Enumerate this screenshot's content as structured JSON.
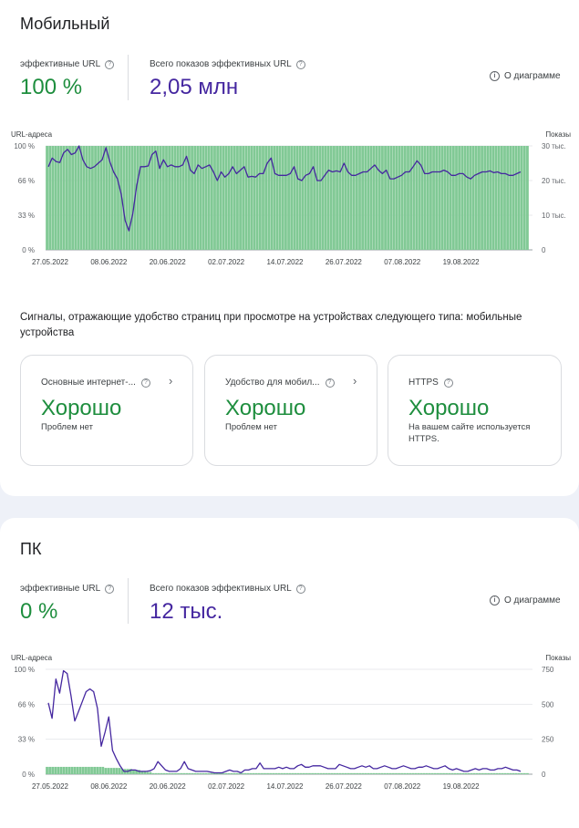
{
  "mobile": {
    "title": "Мобильный",
    "effective_urls_label": "эффективные URL",
    "effective_urls_value": "100 %",
    "impressions_label": "Всего показов эффективных URL",
    "impressions_value": "2,05 млн",
    "about_label": "О диаграмме",
    "signals_text": "Сигналы, отражающие удобство страниц при просмотре на устройствах следующего типа: мобильные устройства",
    "signal_cards": [
      {
        "title": "Основные интернет-...",
        "status": "Хорошо",
        "desc": "Проблем нет"
      },
      {
        "title": "Удобство для мобил...",
        "status": "Хорошо",
        "desc": "Проблем нет"
      },
      {
        "title": "HTTPS",
        "status": "Хорошо",
        "desc": "На вашем сайте используется HTTPS."
      }
    ]
  },
  "pc": {
    "title": "ПК",
    "effective_urls_label": "эффективные URL",
    "effective_urls_value": "0 %",
    "impressions_label": "Всего показов эффективных URL",
    "impressions_value": "12 тыс.",
    "about_label": "О диаграмме"
  },
  "colors": {
    "bars": "#81c995",
    "line": "#4527a0",
    "good": "#1e8e3e"
  },
  "chart_data": [
    {
      "type": "bar",
      "x_tick_labels": [
        "27.05.2022",
        "08.06.2022",
        "20.06.2022",
        "02.07.2022",
        "14.07.2022",
        "26.07.2022",
        "07.08.2022",
        "19.08.2022"
      ],
      "left_axis": {
        "label": "URL-адреса",
        "ticks": [
          "0 %",
          "33 %",
          "66 %",
          "100 %"
        ],
        "range": [
          0,
          100
        ]
      },
      "right_axis": {
        "label": "Показы",
        "ticks": [
          "0",
          "10 тыс.",
          "20 тыс.",
          "30 тыс."
        ],
        "range": [
          0,
          30000
        ]
      },
      "series": [
        {
          "axis": "left",
          "type": "bar",
          "values": [
            100,
            100,
            100,
            100,
            100,
            100,
            100,
            100,
            100,
            100,
            100,
            100,
            100,
            100,
            100,
            100,
            100,
            100,
            100,
            100,
            100,
            100,
            100,
            100,
            100,
            100,
            100,
            100,
            100,
            100,
            100,
            100,
            100,
            100,
            100,
            100,
            100,
            100,
            100,
            100,
            100,
            100,
            100,
            100,
            100,
            100,
            100,
            100,
            100,
            100,
            100,
            100,
            100,
            100,
            100,
            100,
            100,
            100,
            100,
            100,
            100,
            100,
            100,
            100,
            100,
            100,
            100,
            100,
            100,
            100,
            100,
            100,
            100,
            100,
            100,
            100,
            100,
            100,
            100,
            100,
            100,
            100,
            100,
            100,
            100,
            100,
            100,
            100,
            100,
            100,
            100,
            100,
            100,
            100,
            100,
            100,
            100,
            100,
            100,
            100,
            100,
            100,
            100,
            100,
            100,
            100,
            100,
            100,
            100,
            100,
            100,
            100,
            100,
            100,
            100,
            100,
            100,
            100,
            100,
            100,
            100,
            100,
            100,
            100,
            100,
            100,
            100,
            100,
            100,
            100,
            100,
            100,
            100,
            100,
            100,
            100,
            100,
            100,
            100,
            100,
            100,
            100,
            100,
            100,
            100,
            100,
            100,
            100,
            100,
            100,
            100,
            100,
            100,
            100,
            100,
            100,
            100,
            100,
            100,
            100,
            100,
            100,
            100,
            100,
            100,
            100,
            100,
            100,
            100,
            100
          ]
        },
        {
          "axis": "right",
          "type": "line",
          "values": [
            24000,
            26500,
            25500,
            25200,
            28000,
            29000,
            27500,
            28000,
            30000,
            26000,
            24000,
            23500,
            24000,
            25000,
            26000,
            29500,
            25500,
            22500,
            20500,
            16000,
            8500,
            5500,
            10500,
            18500,
            24000,
            24000,
            24200,
            27500,
            28500,
            23500,
            26000,
            24000,
            24500,
            24000,
            24000,
            24500,
            27000,
            23000,
            22000,
            24500,
            23500,
            24000,
            24500,
            22500,
            20000,
            22500,
            21000,
            22000,
            24000,
            22000,
            23000,
            24000,
            21000,
            21200,
            21000,
            22000,
            22000,
            25000,
            26500,
            22000,
            21500,
            21500,
            21500,
            22000,
            24000,
            20500,
            20000,
            21500,
            22000,
            24000,
            20000,
            20000,
            21500,
            23000,
            22500,
            22800,
            22500,
            25000,
            22500,
            21500,
            21500,
            22000,
            22500,
            22500,
            23500,
            24500,
            23000,
            22000,
            23000,
            20500,
            20500,
            21000,
            21500,
            22500,
            22500,
            24000,
            25700,
            24500,
            22000,
            22000,
            22500,
            22500,
            22500,
            23000,
            22500,
            21500,
            21500,
            22000,
            22000,
            21000,
            20500,
            21500,
            22000,
            22500,
            22500,
            22800,
            22300,
            22500,
            22000,
            22000,
            21500,
            21500,
            22000,
            22500
          ]
        }
      ]
    },
    {
      "type": "bar",
      "x_tick_labels": [
        "27.05.2022",
        "08.06.2022",
        "20.06.2022",
        "02.07.2022",
        "14.07.2022",
        "26.07.2022",
        "07.08.2022",
        "19.08.2022"
      ],
      "left_axis": {
        "label": "URL-адреса",
        "ticks": [
          "0 %",
          "33 %",
          "66 %",
          "100 %"
        ],
        "range": [
          0,
          100
        ]
      },
      "right_axis": {
        "label": "Показы",
        "ticks": [
          "0",
          "250",
          "500",
          "750"
        ],
        "range": [
          0,
          750
        ]
      },
      "series": [
        {
          "axis": "left",
          "type": "bar",
          "values": [
            7,
            7,
            7,
            7,
            7,
            7,
            7,
            7,
            7,
            7,
            7,
            7,
            7,
            7,
            7,
            7,
            7,
            7,
            7,
            7,
            7,
            6,
            6,
            6,
            6,
            6,
            6,
            5,
            5,
            5,
            5,
            4,
            4,
            4,
            3,
            3,
            2,
            2,
            1,
            1,
            1,
            1,
            1,
            1,
            1,
            1,
            1,
            1,
            1,
            1,
            1,
            1,
            1,
            1,
            1,
            1,
            1,
            1,
            1,
            1,
            1,
            1,
            1,
            1,
            1,
            1,
            1,
            1,
            1,
            1,
            1,
            1,
            1,
            1,
            1,
            1,
            1,
            1,
            1,
            1,
            1,
            1,
            1,
            1,
            1,
            1,
            1,
            1,
            1,
            1,
            1,
            1,
            1,
            1,
            1,
            1,
            1,
            1,
            1,
            1,
            1,
            1,
            1,
            1,
            1,
            1,
            1,
            1,
            1,
            1,
            1,
            1,
            1,
            1,
            1,
            1,
            1,
            1,
            1,
            1,
            1,
            1,
            1,
            1,
            1,
            1,
            1,
            1,
            1,
            1,
            1,
            1,
            1,
            1,
            1,
            1,
            1,
            1,
            1,
            1,
            1,
            1,
            1,
            1,
            1,
            1,
            1,
            1,
            1,
            1,
            1,
            1,
            1,
            1,
            1,
            1,
            1,
            1,
            1,
            1,
            1,
            1,
            1,
            1,
            1,
            1,
            1,
            1,
            1,
            1,
            1,
            1,
            1
          ]
        },
        {
          "axis": "right",
          "type": "line",
          "values": [
            510,
            400,
            680,
            580,
            740,
            720,
            560,
            380,
            450,
            520,
            590,
            610,
            590,
            470,
            200,
            300,
            410,
            170,
            110,
            60,
            20,
            20,
            30,
            30,
            20,
            20,
            20,
            25,
            40,
            90,
            60,
            30,
            20,
            20,
            20,
            40,
            90,
            40,
            30,
            20,
            20,
            20,
            20,
            15,
            10,
            10,
            10,
            20,
            30,
            20,
            20,
            10,
            30,
            30,
            40,
            40,
            80,
            40,
            40,
            40,
            40,
            50,
            40,
            50,
            40,
            40,
            60,
            70,
            50,
            50,
            60,
            60,
            60,
            50,
            40,
            40,
            40,
            70,
            60,
            50,
            40,
            40,
            50,
            60,
            50,
            60,
            40,
            40,
            50,
            60,
            50,
            40,
            40,
            50,
            60,
            50,
            40,
            40,
            50,
            50,
            60,
            50,
            40,
            40,
            50,
            60,
            40,
            30,
            40,
            30,
            20,
            20,
            30,
            40,
            30,
            40,
            40,
            30,
            30,
            40,
            40,
            50,
            40,
            30,
            30,
            20
          ]
        }
      ]
    }
  ]
}
